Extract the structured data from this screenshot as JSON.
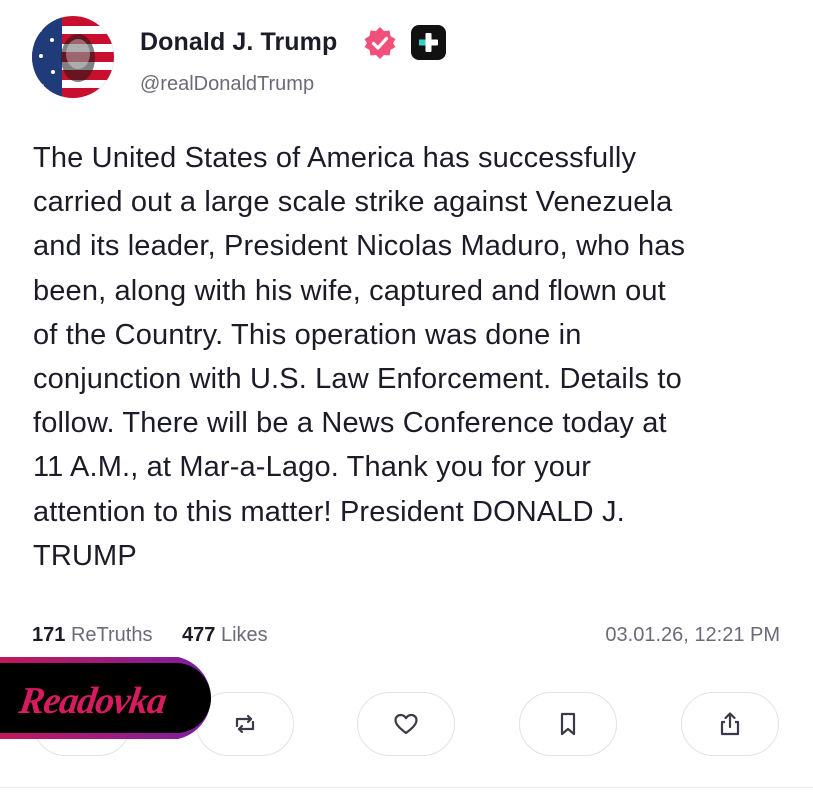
{
  "author": {
    "display_name": "Donald J. Trump",
    "handle": "@realDonaldTrump",
    "avatar_icon": "flag-portrait-avatar",
    "verified_icon": "verified-badge-icon",
    "verified_color": "#f0507a",
    "app_icon": "plus-badge-icon"
  },
  "post": {
    "text": "The United States of America has successfully\ncarried out a large scale strike against Venezuela\nand its leader, President Nicolas Maduro, who has\nbeen, along with his wife, captured and flown out\nof the Country. This operation was done in\nconjunction with U.S. Law Enforcement. Details to\nfollow. There will be a News Conference today at\n11 A.M., at Mar-a-Lago. Thank you for your\nattention to this matter! President DONALD J.\nTRUMP"
  },
  "stats": {
    "retruths_count": "171",
    "retruths_label": "ReTruths",
    "likes_count": "477",
    "likes_label": "Likes",
    "timestamp": "03.01.26, 12:21 PM"
  },
  "actions": [
    {
      "name": "reply",
      "icon": "reply-icon"
    },
    {
      "name": "retruth",
      "icon": "retruth-icon"
    },
    {
      "name": "like",
      "icon": "heart-icon"
    },
    {
      "name": "bookmark",
      "icon": "bookmark-icon"
    },
    {
      "name": "share",
      "icon": "share-icon"
    }
  ],
  "watermark": {
    "logo_text": "Readovka",
    "colors": {
      "primary": "#c2185b",
      "accent": "#7b1fa2"
    }
  }
}
